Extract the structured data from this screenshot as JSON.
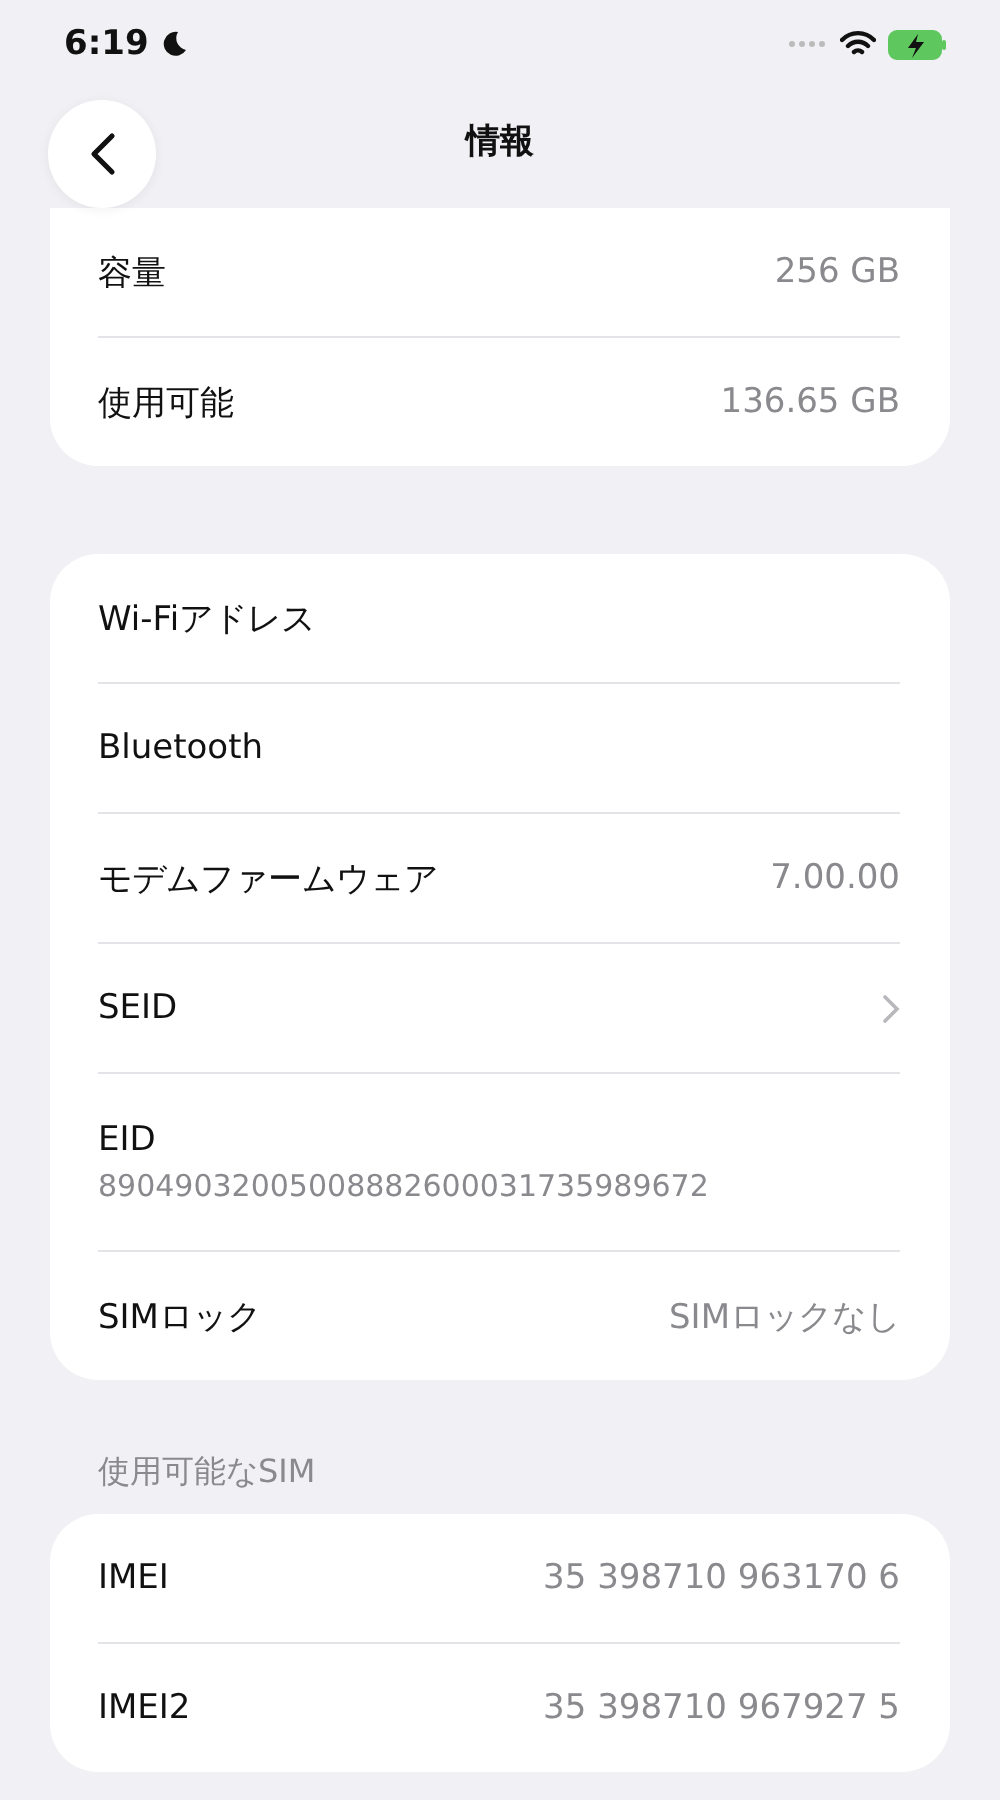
{
  "status_bar": {
    "time": "6:19"
  },
  "nav": {
    "title": "情報"
  },
  "sections": [
    {
      "rows": [
        {
          "kind": "value",
          "label": "容量",
          "value": "256 GB"
        },
        {
          "kind": "value",
          "label": "使用可能",
          "value": "136.65 GB"
        }
      ]
    },
    {
      "rows": [
        {
          "kind": "value",
          "label": "Wi-Fiアドレス"
        },
        {
          "kind": "value",
          "label": "Bluetooth"
        },
        {
          "kind": "value",
          "label": "モデムファームウェア",
          "value": "7.00.00"
        },
        {
          "kind": "link",
          "label": "SEID"
        },
        {
          "kind": "stacked",
          "label": "EID",
          "value": "89049032005008882600031735989672"
        },
        {
          "kind": "value",
          "label": "SIMロック",
          "value": "SIMロックなし"
        }
      ]
    },
    {
      "header": "使用可能なSIM",
      "rows": [
        {
          "kind": "value",
          "label": "IMEI",
          "value": "35 398710 963170 6"
        },
        {
          "kind": "value",
          "label": "IMEI2",
          "value": "35 398710 967927 5"
        }
      ]
    }
  ]
}
